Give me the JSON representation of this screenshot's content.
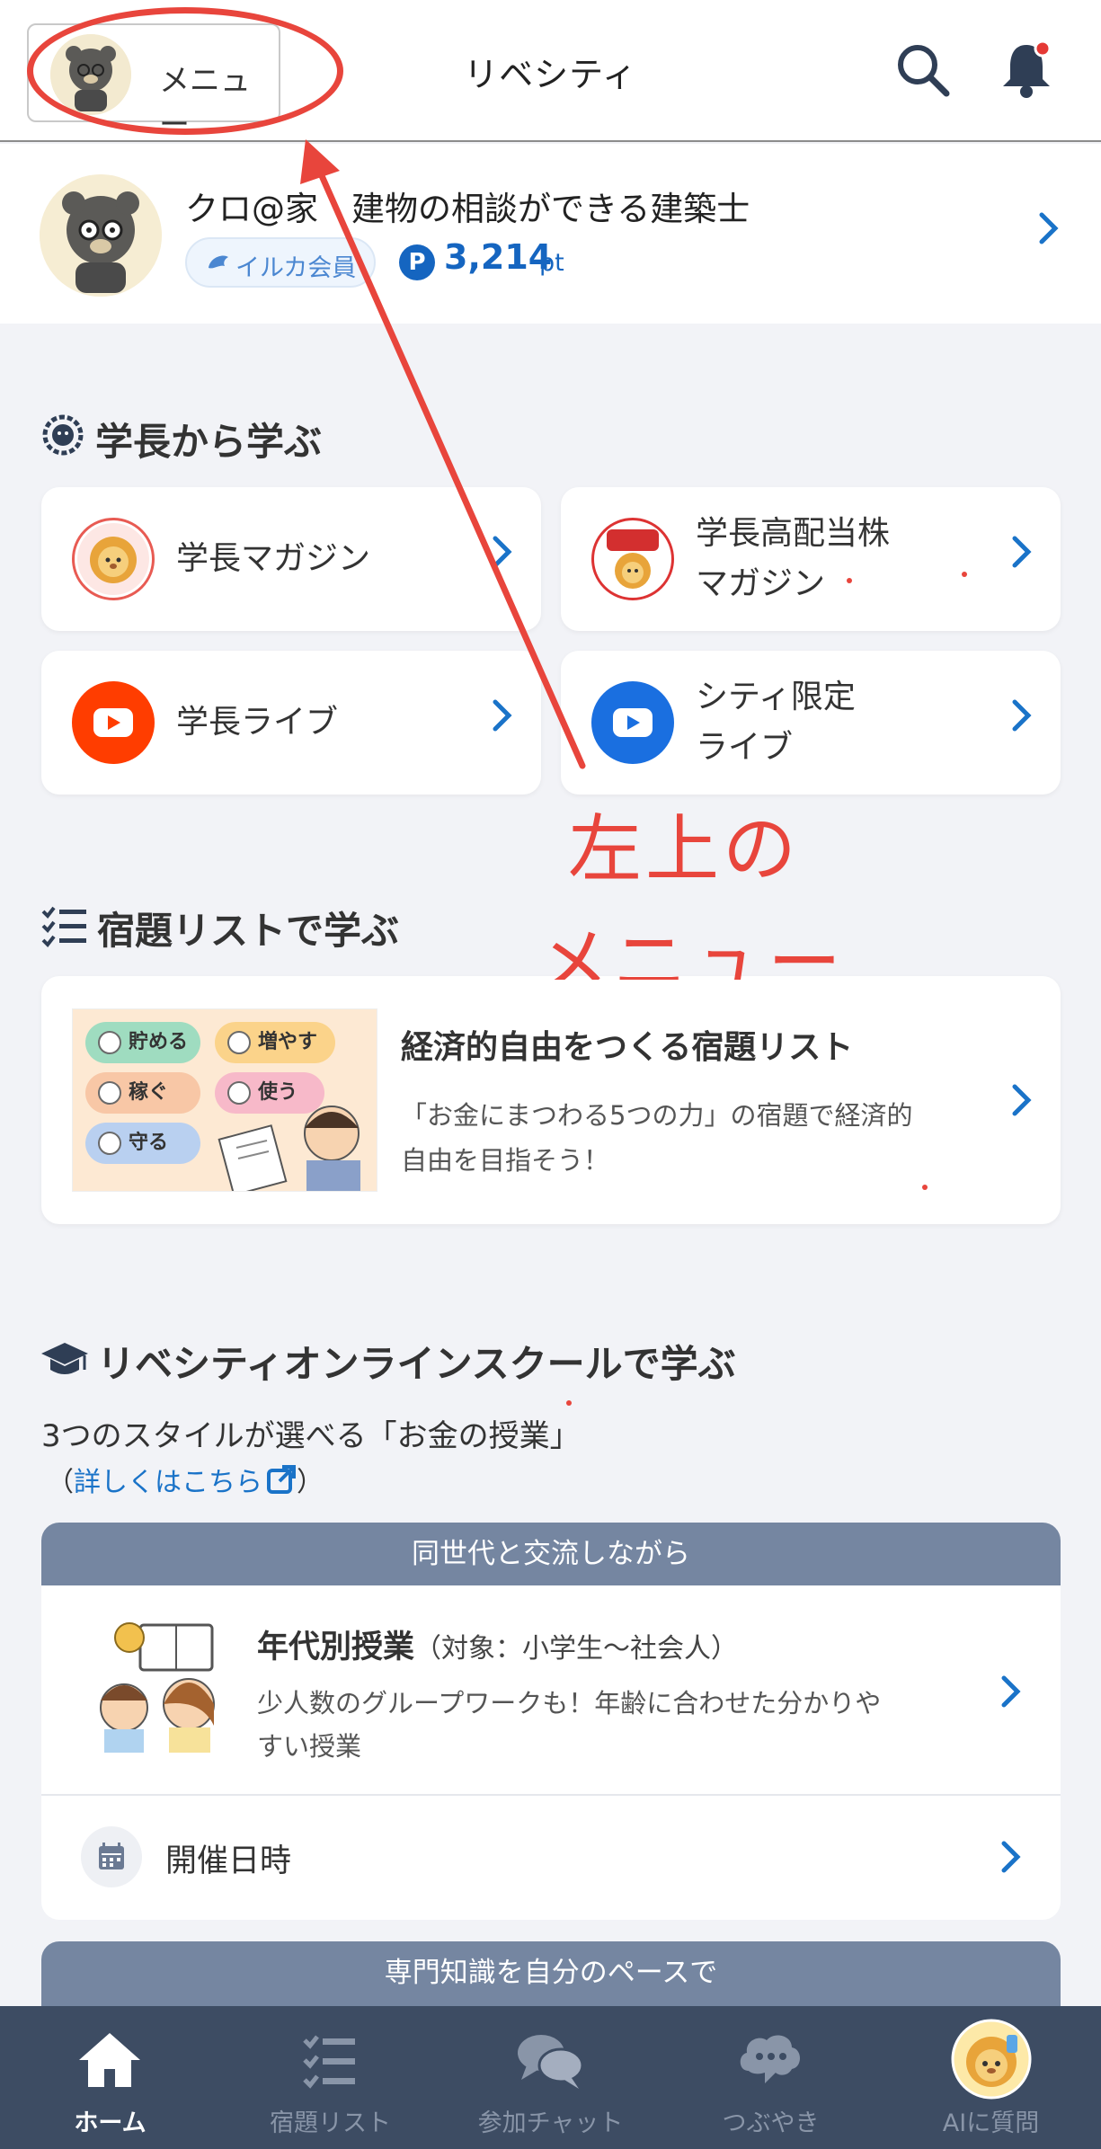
{
  "header": {
    "menu_label": "メニュー",
    "title": "リベシティ",
    "notification_dot_color": "#e53935"
  },
  "profile": {
    "name": "クロ@家　建物の相談ができる建築士",
    "member_badge": "イルカ会員",
    "point_symbol": "P",
    "points": "3,214",
    "point_unit": "pt"
  },
  "section_principal": {
    "title": "学長から学ぶ",
    "cards": [
      {
        "label": "学長マガジン",
        "icon": "lion-mascot-icon"
      },
      {
        "label_line1": "学長高配当株",
        "label_line2": "マガジン",
        "icon": "dividend-stock-icon"
      },
      {
        "label": "学長ライブ",
        "icon": "youtube-red-icon"
      },
      {
        "label_line1": "シティ限定",
        "label_line2": "ライブ",
        "icon": "youtube-blue-icon"
      }
    ]
  },
  "section_homework": {
    "title": "宿題リストで学ぶ",
    "card_title": "経済的自由をつくる宿題リスト",
    "card_desc_line1": "「お金にまつわる5つの力」の宿題で経済的",
    "card_desc_line2": "自由を目指そう！",
    "tags": [
      "貯める",
      "増やす",
      "稼ぐ",
      "使う",
      "守る"
    ]
  },
  "section_school": {
    "title": "リベシティオンラインスクールで学ぶ",
    "subtitle": "3つのスタイルが選べる「お金の授業」",
    "link_open": "（",
    "link_text": "詳しくはこちら",
    "link_close": "）",
    "course1": {
      "header": "同世代と交流しながら",
      "title": "年代別授業",
      "target": "（対象：小学生〜社会人）",
      "desc_line1": "少人数のグループワークも！年齢に合わせた分かりや",
      "desc_line2": "すい授業",
      "schedule_label": "開催日時"
    },
    "course2": {
      "header": "専門知識を自分のペースで"
    }
  },
  "annotation": {
    "line1": "左上の",
    "line2": "メニュー",
    "color": "#e8453c"
  },
  "bottom_nav": {
    "items": [
      {
        "label": "ホーム",
        "icon": "home-icon",
        "active": true
      },
      {
        "label": "宿題リスト",
        "icon": "checklist-icon",
        "active": false
      },
      {
        "label": "参加チャット",
        "icon": "chat-bubbles-icon",
        "active": false
      },
      {
        "label": "つぶやき",
        "icon": "mumble-icon",
        "active": false
      },
      {
        "label": "AIに質問",
        "icon": "ai-lion-icon",
        "active": false
      }
    ]
  },
  "colors": {
    "accent_blue": "#1a73c8",
    "nav_bg": "#3d4c63",
    "course_header_bg": "#7586a1"
  }
}
